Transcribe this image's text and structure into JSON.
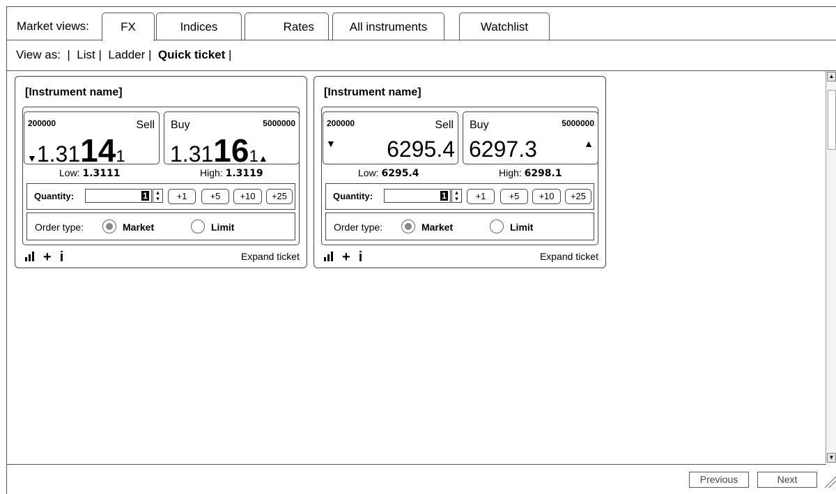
{
  "tabbar": {
    "label": "Market views:",
    "tabs": [
      {
        "label": "FX",
        "active": true
      },
      {
        "label": "Indices",
        "active": false
      },
      {
        "label": "Rates",
        "active": false
      },
      {
        "label": "All instruments",
        "active": false
      },
      {
        "label": "Watchlist",
        "active": false
      }
    ]
  },
  "viewas": {
    "label": "View as:",
    "sep": "|",
    "options": [
      "List",
      "Ladder",
      "Quick ticket"
    ],
    "selected": "Quick ticket"
  },
  "tickets": [
    {
      "title": "[Instrument name]",
      "sell": {
        "qty": "200000",
        "label": "Sell",
        "price_prefix": "1.31",
        "price_big": "14",
        "price_tail": "1"
      },
      "buy": {
        "qty": "5000000",
        "label": "Buy",
        "price_prefix": "1.31",
        "price_big": "16",
        "price_tail": "1"
      },
      "low_label": "Low:",
      "low": "1.3111",
      "high_label": "High:",
      "high": "1.3119",
      "quantity_label": "Quantity:",
      "quantity": "1",
      "increments": [
        "+1",
        "+5",
        "+10",
        "+25"
      ],
      "order_type_label": "Order type:",
      "market_label": "Market",
      "limit_label": "Limit",
      "selected_order_type": "Market",
      "expand_label": "Expand ticket"
    },
    {
      "title": "[Instrument name]",
      "sell": {
        "qty": "200000",
        "label": "Sell",
        "price": "6295.4"
      },
      "buy": {
        "qty": "5000000",
        "label": "Buy",
        "price": "6297.3"
      },
      "low_label": "Low:",
      "low": "6295.4",
      "high_label": "High:",
      "high": "6298.1",
      "quantity_label": "Quantity:",
      "quantity": "1",
      "increments": [
        "+1",
        "+5",
        "+10",
        "+25"
      ],
      "order_type_label": "Order type:",
      "market_label": "Market",
      "limit_label": "Limit",
      "selected_order_type": "Market",
      "expand_label": "Expand ticket"
    }
  ],
  "footer_icons": {
    "chart": "bar-chart-icon",
    "add": "+",
    "info": "i"
  },
  "pager": {
    "previous": "Previous",
    "next": "Next"
  },
  "icons": {
    "sell_arrow": "down-arrow-icon",
    "buy_arrow": "up-arrow-icon"
  }
}
